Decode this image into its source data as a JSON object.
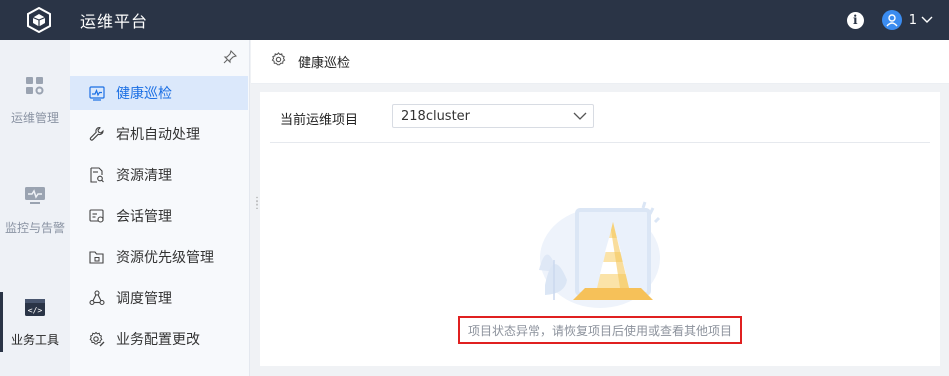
{
  "app": {
    "title": "运维平台"
  },
  "topbar": {
    "user": "1"
  },
  "rail": {
    "items": [
      {
        "label": "运维管理"
      },
      {
        "label": "监控与告警"
      },
      {
        "label": "业务工具"
      }
    ]
  },
  "subnav": {
    "items": [
      {
        "label": "健康巡检"
      },
      {
        "label": "宕机自动处理"
      },
      {
        "label": "资源清理"
      },
      {
        "label": "会话管理"
      },
      {
        "label": "资源优先级管理"
      },
      {
        "label": "调度管理"
      },
      {
        "label": "业务配置更改"
      }
    ]
  },
  "page": {
    "title": "健康巡检"
  },
  "filter": {
    "label": "当前运维项目",
    "value": "218cluster"
  },
  "empty": {
    "message": "项目状态异常，请恢复项目后使用或查看其他项目"
  },
  "colors": {
    "topbar": "#2a3446",
    "accent": "#1b6fe4",
    "active_bg": "#dbe8fb",
    "error_border": "#e02020"
  },
  "icons": [
    "cube-logo-icon",
    "info-icon",
    "user-avatar-icon",
    "chevron-down-icon",
    "pin-icon",
    "gear-icon"
  ]
}
